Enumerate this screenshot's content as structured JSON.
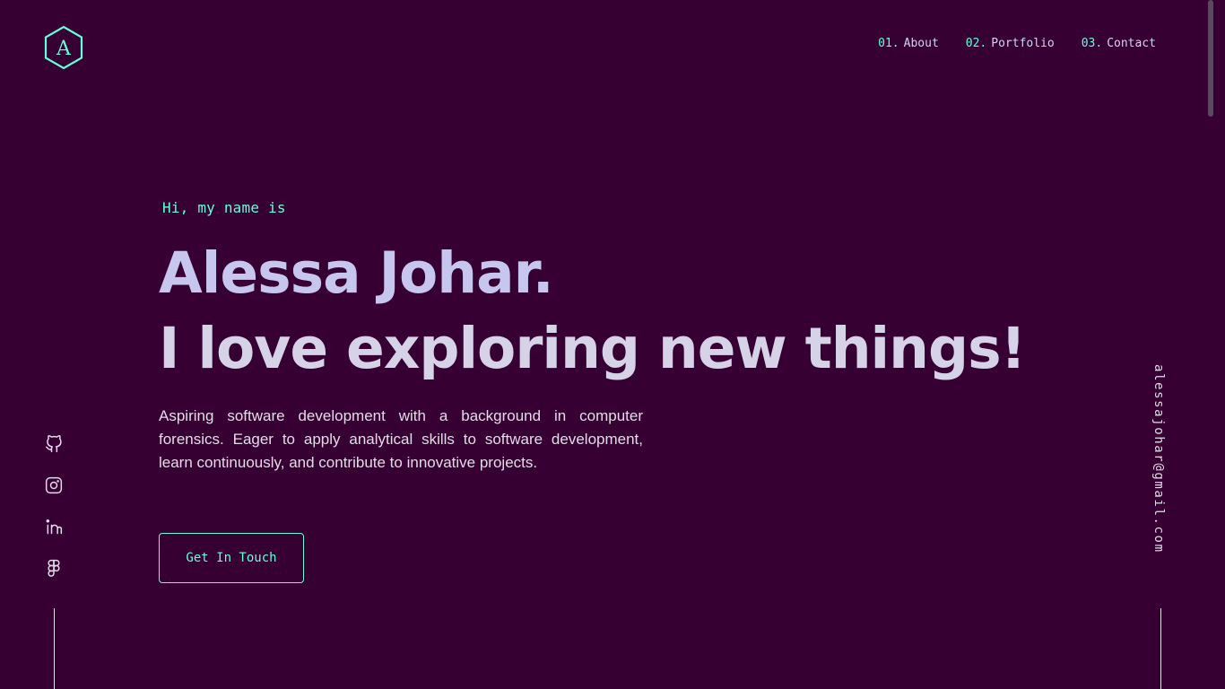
{
  "logo": {
    "letter": "A",
    "accent_color": "#64ffda"
  },
  "nav": {
    "items": [
      {
        "number": "01.",
        "label": "About"
      },
      {
        "number": "02.",
        "label": "Portfolio"
      },
      {
        "number": "03.",
        "label": "Contact"
      }
    ]
  },
  "hero": {
    "greeting": "Hi, my name is",
    "name": "Alessa Johar.",
    "tagline": "I love exploring new things!",
    "intro": "Aspiring software development with a background in computer forensics. Eager to apply analytical skills to software development, learn continuously, and contribute to innovative projects.",
    "cta_label": "Get In Touch"
  },
  "socials": [
    {
      "icon": "github-icon"
    },
    {
      "icon": "instagram-icon"
    },
    {
      "icon": "linkedin-icon"
    },
    {
      "icon": "figma-icon"
    }
  ],
  "email": "alessajohar@gmail.com",
  "colors": {
    "background": "#370032",
    "accent": "#64ffda",
    "heading": "#c6c6ee",
    "text": "#e2dbe8"
  }
}
